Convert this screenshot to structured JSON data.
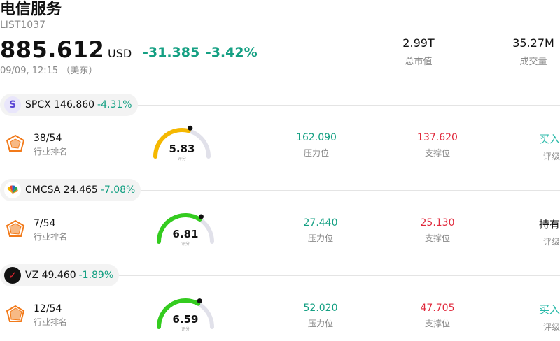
{
  "header": {
    "title": "电信服务",
    "code": "LIST1037",
    "price": "885.612",
    "currency": "USD",
    "change": "-31.385 -3.42%",
    "datetime": "09/09, 12:15 （美东）",
    "market_cap_value": "2.99T",
    "market_cap_label": "总市值",
    "volume_value": "35.27M",
    "volume_label": "成交量"
  },
  "stocks": [
    {
      "logo_text": "S",
      "symbol_price": "SPCX 146.860",
      "change": "-4.31%",
      "rank": "38/54",
      "rank_label": "行业排名",
      "score": "5.83",
      "score_fraction": 0.583,
      "score_label": "评分",
      "resistance": "162.090",
      "resistance_label": "压力位",
      "support": "137.620",
      "support_label": "支撑位",
      "rating": "买入",
      "rating_label": "评级"
    },
    {
      "logo_text": "",
      "symbol_price": "CMCSA 24.465",
      "change": "-7.08%",
      "rank": "7/54",
      "rank_label": "行业排名",
      "score": "6.81",
      "score_fraction": 0.681,
      "score_label": "评分",
      "resistance": "27.440",
      "resistance_label": "压力位",
      "support": "25.130",
      "support_label": "支撑位",
      "rating": "持有",
      "rating_label": "评级"
    },
    {
      "logo_text": "✓",
      "symbol_price": "VZ 49.460",
      "change": "-1.89%",
      "rank": "12/54",
      "rank_label": "行业排名",
      "score": "6.59",
      "score_fraction": 0.659,
      "score_label": "评分",
      "resistance": "52.020",
      "resistance_label": "压力位",
      "support": "47.705",
      "support_label": "支撑位",
      "rating": "买入",
      "rating_label": "评级"
    }
  ],
  "colors": {
    "up_green": "#15a083",
    "down_red": "#e0293c",
    "buy_teal": "#28b9a8",
    "gauge_yellow": "#f5b800",
    "gauge_green": "#34cc1f",
    "gauge_track": "#e1e1ea"
  }
}
